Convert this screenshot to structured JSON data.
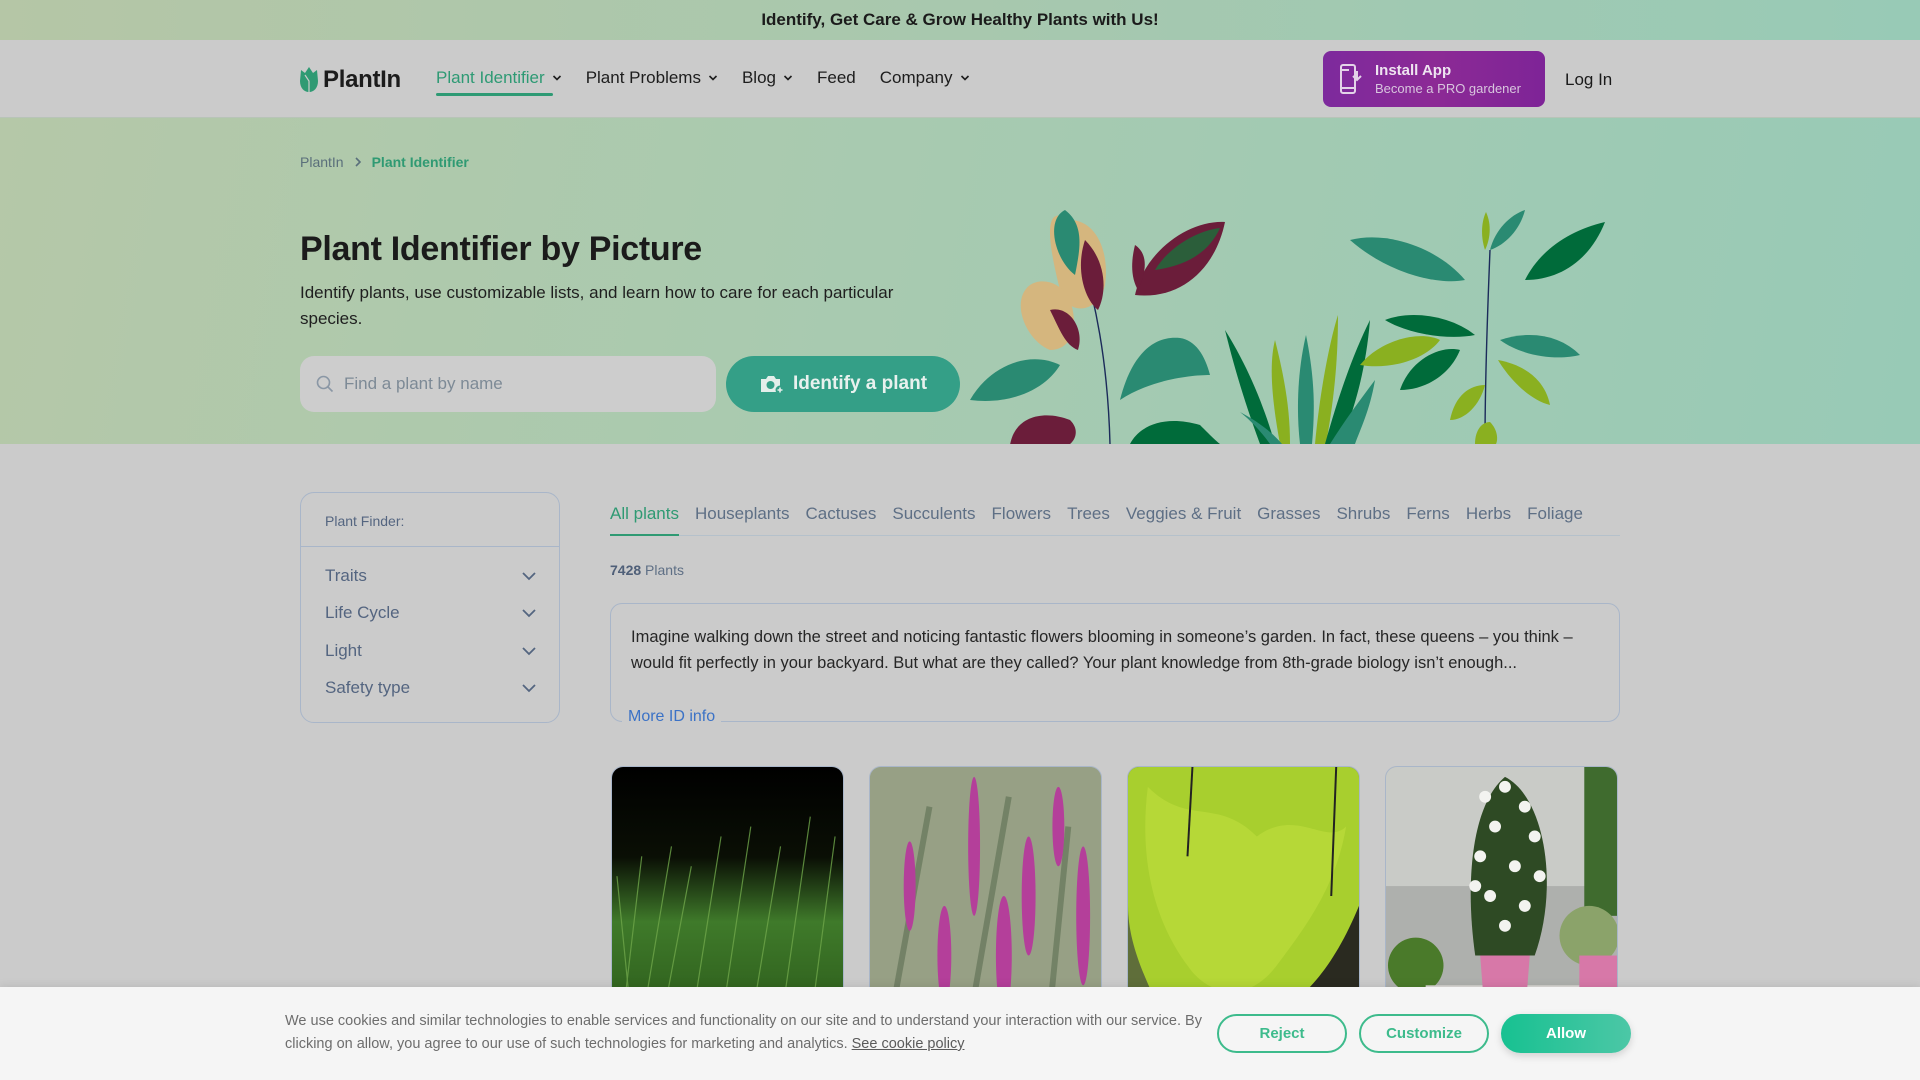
{
  "banner": {
    "text": "Identify, Get Care & Grow Healthy Plants with Us!"
  },
  "nav": {
    "logo": "PlantIn",
    "links": [
      {
        "label": "Plant Identifier",
        "dropdown": true,
        "active": true
      },
      {
        "label": "Plant Problems",
        "dropdown": true
      },
      {
        "label": "Blog",
        "dropdown": true
      },
      {
        "label": "Feed",
        "dropdown": false
      },
      {
        "label": "Company",
        "dropdown": true
      }
    ],
    "install": {
      "title": "Install App",
      "subtitle": "Become a PRO gardener"
    },
    "login": "Log In"
  },
  "breadcrumb": {
    "home": "PlantIn",
    "current": "Plant Identifier"
  },
  "hero": {
    "title": "Plant Identifier by Picture",
    "subtitle": "Identify plants, use customizable lists, and learn how to care for each particular species.",
    "search_placeholder": "Find a plant by name",
    "identify_label": "Identify a plant"
  },
  "finder": {
    "title": "Plant Finder:",
    "items": [
      "Traits",
      "Life Cycle",
      "Light",
      "Safety type"
    ]
  },
  "tabs": [
    "All plants",
    "Houseplants",
    "Cactuses",
    "Succulents",
    "Flowers",
    "Trees",
    "Veggies & Fruit",
    "Grasses",
    "Shrubs",
    "Ferns",
    "Herbs",
    "Foliage"
  ],
  "active_tab": "All plants",
  "count": {
    "number": "7428",
    "label": "Plants"
  },
  "intro": {
    "text": "Imagine walking down the street and noticing fantastic flowers blooming in someone’s garden. In fact, these queens – you think – would fit perfectly in your backyard. But what are they called? Your plant knowledge from 8th-grade biology isn’t enough...",
    "more_label": "More ID info"
  },
  "cards": [
    {
      "image": "grass-photo"
    },
    {
      "image": "celosia-photo"
    },
    {
      "image": "fern-photo"
    },
    {
      "image": "mandevilla-photo"
    }
  ],
  "cookie": {
    "text": "We use cookies and similar technologies to enable services and functionality on our site and to understand your interaction with our service. By clicking on allow, you agree to our use of such technologies for marketing and analytics.",
    "link": "See cookie policy",
    "reject": "Reject",
    "customize": "Customize",
    "allow": "Allow"
  },
  "colors": {
    "brand_green": "#2f9a73",
    "install_purple": "#8c2a95",
    "identify_button": "#349f87",
    "allow_button": "#17c191",
    "link_blue": "#3b72c6"
  }
}
